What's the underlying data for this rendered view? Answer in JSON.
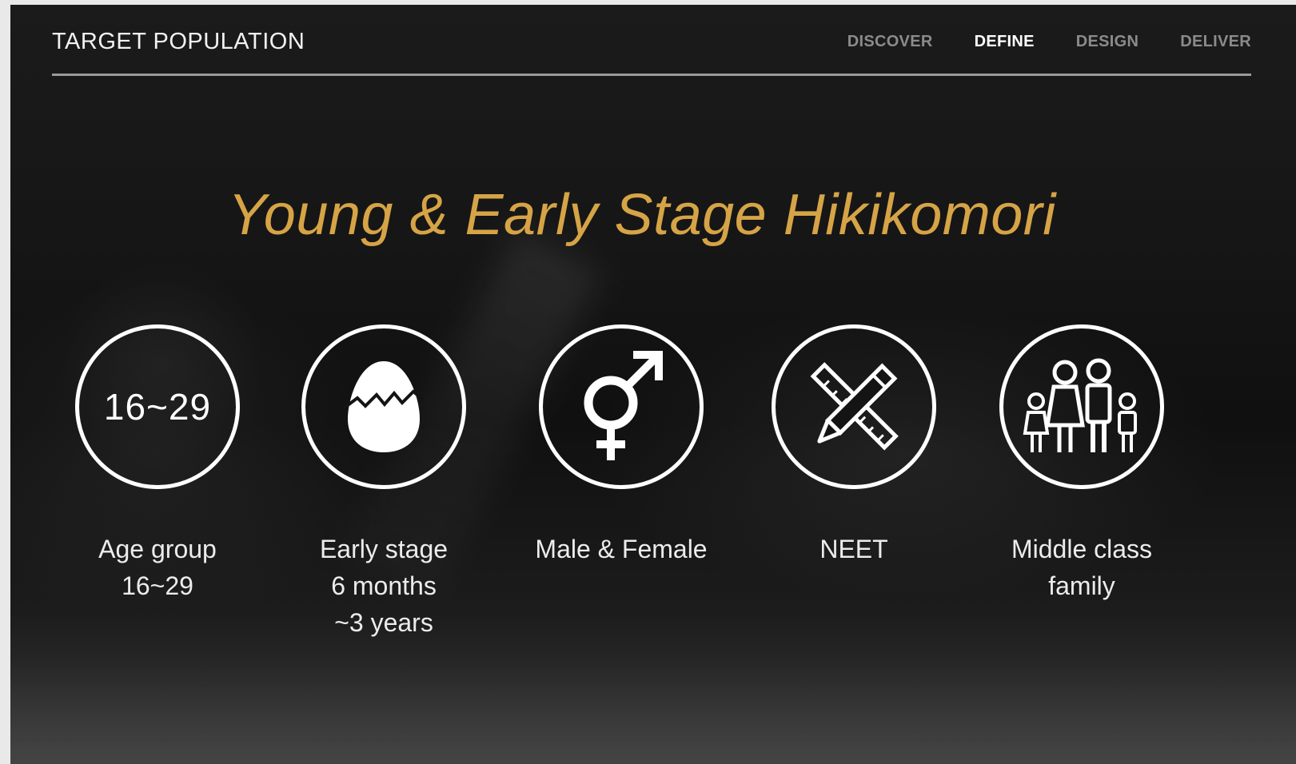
{
  "header": {
    "title": "TARGET POPULATION",
    "nav": [
      {
        "label": "DISCOVER",
        "active": false
      },
      {
        "label": "DEFINE",
        "active": true
      },
      {
        "label": "DESIGN",
        "active": false
      },
      {
        "label": "DELIVER",
        "active": false
      }
    ]
  },
  "headline": "Young & Early Stage Hikikomori",
  "colors": {
    "accent": "#d6a446",
    "background": "#141414",
    "text": "#ffffff",
    "nav_inactive": "#8b8b8b"
  },
  "items": [
    {
      "icon": "age-number",
      "circle_text": "16~29",
      "label_lines": [
        "Age group",
        "16~29"
      ]
    },
    {
      "icon": "cracked-egg-icon",
      "label_lines": [
        "Early stage",
        "6 months",
        "~3 years"
      ]
    },
    {
      "icon": "gender-symbol-icon",
      "label_lines": [
        "Male & Female"
      ]
    },
    {
      "icon": "pencil-ruler-cross-icon",
      "label_lines": [
        "NEET"
      ]
    },
    {
      "icon": "family-icon",
      "label_lines": [
        "Middle class",
        "family"
      ]
    }
  ]
}
